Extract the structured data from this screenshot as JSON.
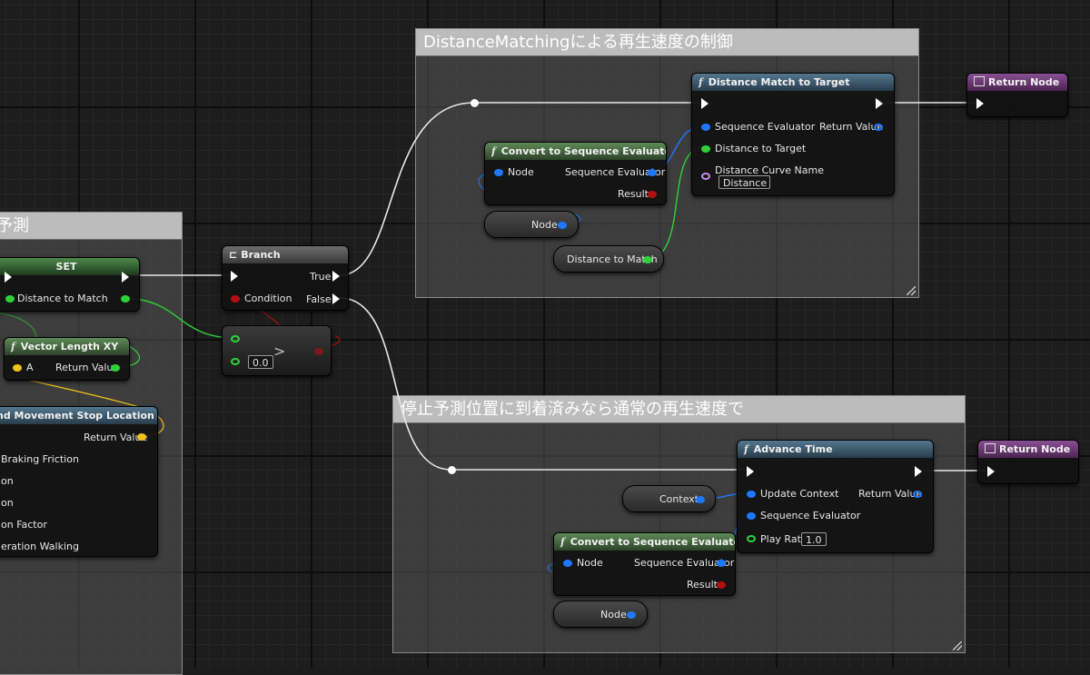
{
  "comments": {
    "distance_matching": "DistanceMatchingによる再生速度の制御",
    "left": "予測",
    "stop": "停止予測位置に到着済みなら通常の再生速度で"
  },
  "nodes": {
    "set": {
      "title": "SET",
      "distance_to_match": "Distance to Match"
    },
    "vector_length": {
      "title": "Vector Length XY",
      "a": "A",
      "return_value": "Return Value"
    },
    "stop_location": {
      "title": "nd Movement Stop Location",
      "return_value": "Return Value",
      "braking_friction": "Braking Friction",
      "row_on1": "on",
      "row_on2": "on",
      "factor": "on Factor",
      "walking": "eration Walking"
    },
    "branch": {
      "title": "Branch",
      "condition": "Condition",
      "true_label": "True",
      "false_label": "False"
    },
    "compare": {
      "op": ">",
      "value": "0.0"
    },
    "convert1": {
      "title": "Convert to Sequence Evaluator",
      "node": "Node",
      "seq_eval": "Sequence Evaluator",
      "result": "Result"
    },
    "node_var1": {
      "label": "Node"
    },
    "distance_var": {
      "label": "Distance to Match"
    },
    "distance_match": {
      "title": "Distance Match to Target",
      "seq_eval": "Sequence Evaluator",
      "return_value": "Return Value",
      "distance_to_target": "Distance to Target",
      "curve_name": "Distance Curve Name",
      "curve_value": "Distance"
    },
    "return1": {
      "title": "Return Node"
    },
    "advance": {
      "title": "Advance Time",
      "update_context": "Update Context",
      "return_value": "Return Value",
      "seq_eval": "Sequence Evaluator",
      "play_rate": "Play Rate",
      "play_rate_value": "1.0"
    },
    "context_var": {
      "label": "Context"
    },
    "convert2": {
      "title": "Convert to Sequence Evaluator",
      "node": "Node",
      "seq_eval": "Sequence Evaluator",
      "result": "Result"
    },
    "node_var2": {
      "label": "Node"
    },
    "return2": {
      "title": "Return Node"
    }
  },
  "icons": {
    "function": "function-icon",
    "branch": "branch-icon",
    "return": "return-node-icon",
    "resize": "resize-grip-icon"
  },
  "colors": {
    "exec_wire": "#ffffff",
    "struct_pin": "#1e78ff",
    "float_pin": "#2fd13a",
    "bool_pin": "#b01010",
    "vector_pin": "#f2c21a",
    "name_pin": "#c88ce8",
    "pure_func_header": "#5e8a57",
    "func_header": "#54778f",
    "return_header": "#8a4f94"
  }
}
